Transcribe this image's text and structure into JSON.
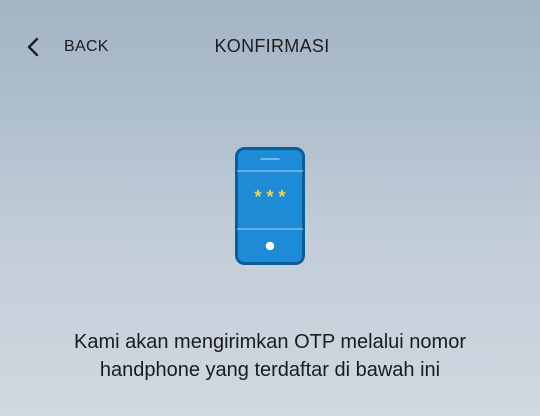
{
  "header": {
    "back_label": "BACK",
    "back_icon": "chevron-left-icon",
    "title": "KONFIRMASI"
  },
  "illustration": {
    "icon": "phone-otp-icon",
    "masked_code": "* * *",
    "colors": {
      "phone_body": "#1e8bd6",
      "phone_border": "#0d5d99",
      "code_stars": "#f5d34a",
      "lines": "#8fc6ee"
    }
  },
  "message": {
    "line1": "Kami akan mengirimkan OTP melalui nomor",
    "line2": "handphone yang terdaftar di bawah ini"
  }
}
